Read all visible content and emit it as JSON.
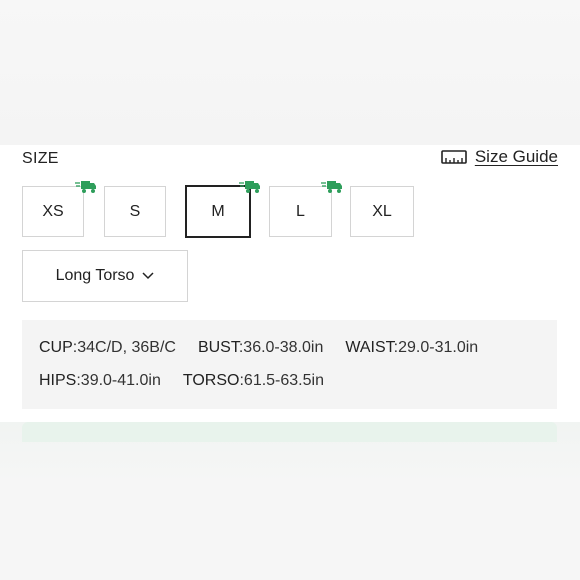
{
  "size_section": {
    "label": "SIZE",
    "size_guide_label": "Size Guide"
  },
  "sizes": [
    {
      "label": "XS",
      "fast_ship": true,
      "selected": false
    },
    {
      "label": "S",
      "fast_ship": false,
      "selected": false
    },
    {
      "label": "M",
      "fast_ship": true,
      "selected": true
    },
    {
      "label": "L",
      "fast_ship": true,
      "selected": false
    },
    {
      "label": "XL",
      "fast_ship": false,
      "selected": false
    }
  ],
  "torso_select": {
    "value": "Long Torso"
  },
  "measurements": {
    "cup": {
      "key": "CUP",
      "value": ":34C/D, 36B/C"
    },
    "bust": {
      "key": "BUST",
      "value": ":36.0-38.0in"
    },
    "waist": {
      "key": "WAIST",
      "value": ":29.0-31.0in"
    },
    "hips": {
      "key": "HIPS",
      "value": ":39.0-41.0in"
    },
    "torso": {
      "key": "TORSO",
      "value": ":61.5-63.5in"
    }
  },
  "colors": {
    "accent_green": "#2e9e5b",
    "selected_border": "#222222",
    "border": "#d4d4d4"
  }
}
